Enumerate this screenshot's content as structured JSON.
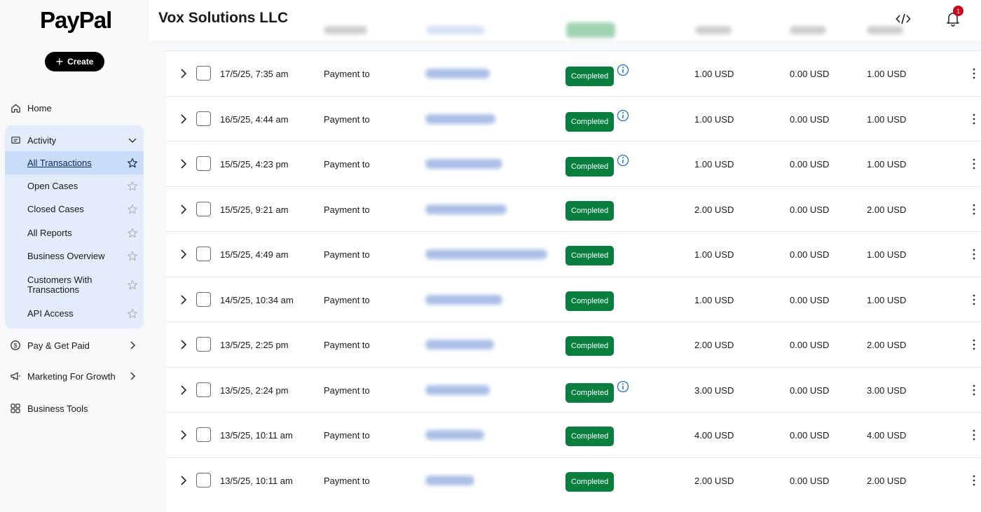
{
  "brand": {
    "logo_text": "PayPal",
    "accent": "#07803e"
  },
  "sidebar": {
    "create_label": "Create",
    "home_label": "Home",
    "activity_label": "Activity",
    "activity_items": [
      {
        "label": "All Transactions",
        "active": true
      },
      {
        "label": "Open Cases"
      },
      {
        "label": "Closed Cases"
      },
      {
        "label": "All Reports"
      },
      {
        "label": "Business Overview"
      },
      {
        "label": "Customers With Transactions"
      },
      {
        "label": "API Access"
      }
    ],
    "pay_label": "Pay & Get Paid",
    "marketing_label": "Marketing For Growth",
    "tools_label": "Business Tools"
  },
  "header": {
    "company": "Vox Solutions LLC",
    "notification_count": "1"
  },
  "transactions": [
    {
      "date": "17/5/25, 7:35 am",
      "desc": "Payment to",
      "status": "Completed",
      "info": true,
      "gross": "1.00 USD",
      "fee": "0.00 USD",
      "net": "1.00 USD"
    },
    {
      "date": "16/5/25, 4:44 am",
      "desc": "Payment to",
      "status": "Completed",
      "info": true,
      "gross": "1.00 USD",
      "fee": "0.00 USD",
      "net": "1.00 USD"
    },
    {
      "date": "15/5/25, 4:23 pm",
      "desc": "Payment to",
      "status": "Completed",
      "info": true,
      "gross": "1.00 USD",
      "fee": "0.00 USD",
      "net": "1.00 USD"
    },
    {
      "date": "15/5/25, 9:21 am",
      "desc": "Payment to",
      "status": "Completed",
      "info": false,
      "gross": "2.00 USD",
      "fee": "0.00 USD",
      "net": "2.00 USD"
    },
    {
      "date": "15/5/25, 4:49 am",
      "desc": "Payment to",
      "status": "Completed",
      "info": false,
      "gross": "1.00 USD",
      "fee": "0.00 USD",
      "net": "1.00 USD"
    },
    {
      "date": "14/5/25, 10:34 am",
      "desc": "Payment to",
      "status": "Completed",
      "info": false,
      "gross": "1.00 USD",
      "fee": "0.00 USD",
      "net": "1.00 USD"
    },
    {
      "date": "13/5/25, 2:25 pm",
      "desc": "Payment to",
      "status": "Completed",
      "info": false,
      "gross": "2.00 USD",
      "fee": "0.00 USD",
      "net": "2.00 USD"
    },
    {
      "date": "13/5/25, 2:24 pm",
      "desc": "Payment to",
      "status": "Completed",
      "info": true,
      "gross": "3.00 USD",
      "fee": "0.00 USD",
      "net": "3.00 USD"
    },
    {
      "date": "13/5/25, 10:11 am",
      "desc": "Payment to",
      "status": "Completed",
      "info": false,
      "gross": "4.00 USD",
      "fee": "0.00 USD",
      "net": "4.00 USD"
    },
    {
      "date": "13/5/25, 10:11 am",
      "desc": "Payment to",
      "status": "Completed",
      "info": false,
      "gross": "2.00 USD",
      "fee": "0.00 USD",
      "net": "2.00 USD"
    }
  ]
}
